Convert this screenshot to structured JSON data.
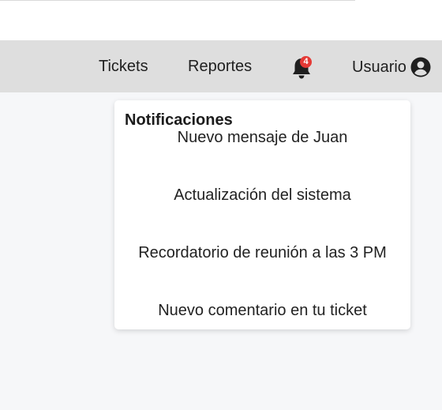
{
  "navbar": {
    "links": [
      "Tickets",
      "Reportes"
    ],
    "notifications_count": "4",
    "user_label": "Usuario",
    "icons": {
      "bell": "bell-icon",
      "user": "user-circle-icon"
    },
    "colors": {
      "navbar_bg": "#dedede",
      "badge": "#e53935"
    }
  },
  "notifications": {
    "title": "Notificaciones",
    "items": [
      "Nuevo mensaje de Juan",
      "Actualización del sistema",
      "Recordatorio de reunión a las 3 PM",
      "Nuevo comentario en tu ticket"
    ]
  }
}
